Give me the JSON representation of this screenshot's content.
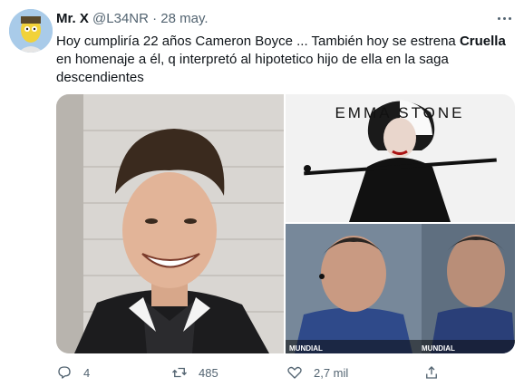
{
  "tweet": {
    "display_name": "Mr. X",
    "handle": "@L34NR",
    "separator": "·",
    "date": "28 may.",
    "text_part1": "Hoy cumpliría 22 años Cameron Boyce ... También hoy se estrena ",
    "text_bold": "Cruella",
    "text_part2": " en homenaje a él, q interpretó al hipotetico hijo de ella en la saga descendientes"
  },
  "media": {
    "poster_title": "EMMA STONE",
    "tv_caption_1": "MUNDIAL",
    "tv_caption_2": "MUNDIAL"
  },
  "actions": {
    "replies": "4",
    "retweets": "485",
    "likes": "2,7 mil"
  },
  "icons": {
    "avatar": "avatar-icon",
    "more": "more-options-icon",
    "reply": "reply-icon",
    "retweet": "retweet-icon",
    "like": "heart-icon",
    "share": "share-icon"
  },
  "colors": {
    "text": "#0f1419",
    "secondary": "#536471"
  }
}
